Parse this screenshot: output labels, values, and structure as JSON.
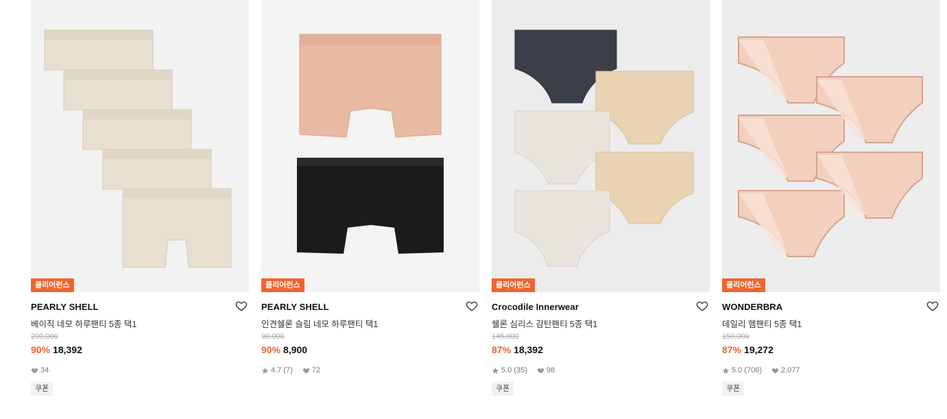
{
  "products": [
    {
      "badge": "클리어런스",
      "brand": "PEARLY SHELL",
      "name": "베이직 네모 하루팬티 5종 택1",
      "original_price": "200,000",
      "discount": "90%",
      "price": "18,392",
      "rating": "",
      "review_count": "",
      "likes": "34",
      "coupon": "쿠폰",
      "bg": "#f2f2f2",
      "garment": "boxer",
      "colors": [
        "#e7dfcf"
      ]
    },
    {
      "badge": "클리어런스",
      "brand": "PEARLY SHELL",
      "name": "인견쉘론 슬림 네모 하루팬티 택1",
      "original_price": "90,000",
      "discount": "90%",
      "price": "8,900",
      "rating": "4.7",
      "review_count": "(7)",
      "likes": "72",
      "coupon": "",
      "bg": "#f4f4f4",
      "garment": "boxer",
      "colors": [
        "#e8baa2",
        "#1b1b1b"
      ]
    },
    {
      "badge": "클리어런스",
      "brand": "Crocodile Innerwear",
      "name": "쉘론 심리스 감탄팬티 5종 택1",
      "original_price": "145,000",
      "discount": "87%",
      "price": "18,392",
      "rating": "5.0",
      "review_count": "(35)",
      "likes": "98",
      "coupon": "쿠폰",
      "bg": "#ececec",
      "garment": "brief",
      "colors": [
        "#3b3f4a",
        "#ead3b3",
        "#e9e4de",
        "#ead3b3",
        "#e9e4de"
      ]
    },
    {
      "badge": "클리어런스",
      "brand": "WONDERBRA",
      "name": "데일리 헴팬티 5종 택1",
      "original_price": "150,000",
      "discount": "87%",
      "price": "19,272",
      "rating": "5.0",
      "review_count": "(706)",
      "likes": "2,077",
      "coupon": "쿠폰",
      "bg": "#ededed",
      "garment": "hem",
      "colors": [
        "#f3cfbd"
      ]
    }
  ]
}
